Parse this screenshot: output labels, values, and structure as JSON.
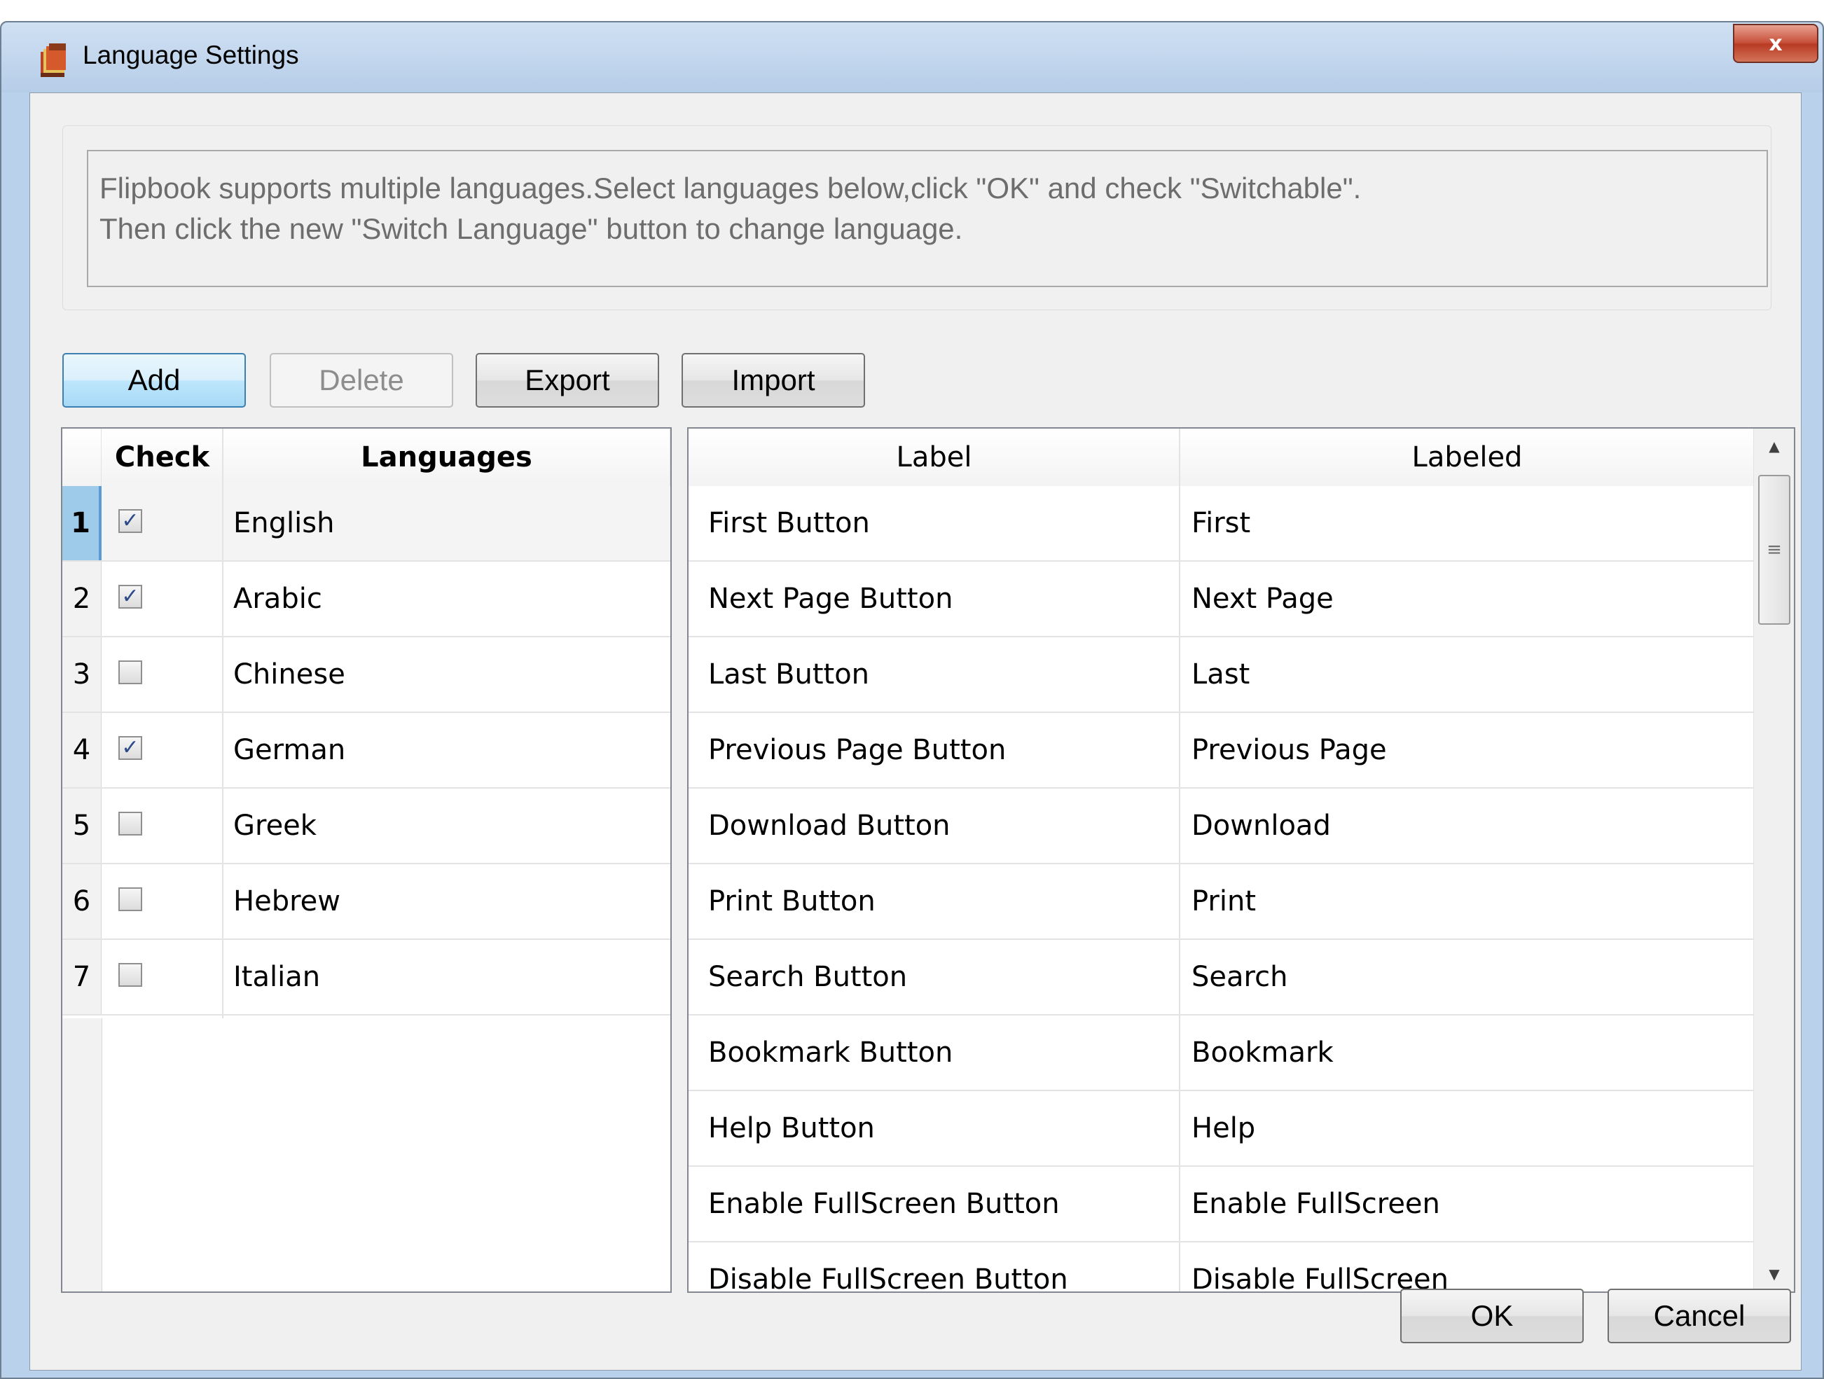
{
  "window": {
    "title": "Language Settings",
    "close_label": "x"
  },
  "info": {
    "line1": "Flipbook supports multiple languages.Select languages below,click \"OK\" and check \"Switchable\".",
    "line2": "Then click the new \"Switch Language\" button to change language."
  },
  "toolbar": {
    "add_label": "Add",
    "delete_label": "Delete",
    "export_label": "Export",
    "import_label": "Import"
  },
  "languages_grid": {
    "headers": {
      "check": "Check",
      "languages": "Languages"
    },
    "rows": [
      {
        "num": "1",
        "checked": true,
        "language": "English"
      },
      {
        "num": "2",
        "checked": true,
        "language": "Arabic"
      },
      {
        "num": "3",
        "checked": false,
        "language": "Chinese"
      },
      {
        "num": "4",
        "checked": true,
        "language": "German"
      },
      {
        "num": "5",
        "checked": false,
        "language": "Greek"
      },
      {
        "num": "6",
        "checked": false,
        "language": "Hebrew"
      },
      {
        "num": "7",
        "checked": false,
        "language": "Italian"
      }
    ]
  },
  "labels_grid": {
    "headers": {
      "label": "Label",
      "labeled": "Labeled"
    },
    "rows": [
      {
        "label": "First Button",
        "labeled": "First"
      },
      {
        "label": "Next Page Button",
        "labeled": "Next Page"
      },
      {
        "label": "Last Button",
        "labeled": "Last"
      },
      {
        "label": "Previous Page Button",
        "labeled": "Previous Page"
      },
      {
        "label": "Download Button",
        "labeled": "Download"
      },
      {
        "label": "Print Button",
        "labeled": "Print"
      },
      {
        "label": "Search Button",
        "labeled": "Search"
      },
      {
        "label": "Bookmark Button",
        "labeled": "Bookmark"
      },
      {
        "label": "Help Button",
        "labeled": "Help"
      },
      {
        "label": "Enable FullScreen Button",
        "labeled": "Enable FullScreen"
      },
      {
        "label": "Disable FullScreen Button",
        "labeled": "Disable FullScreen"
      }
    ]
  },
  "footer": {
    "ok_label": "OK",
    "cancel_label": "Cancel"
  }
}
